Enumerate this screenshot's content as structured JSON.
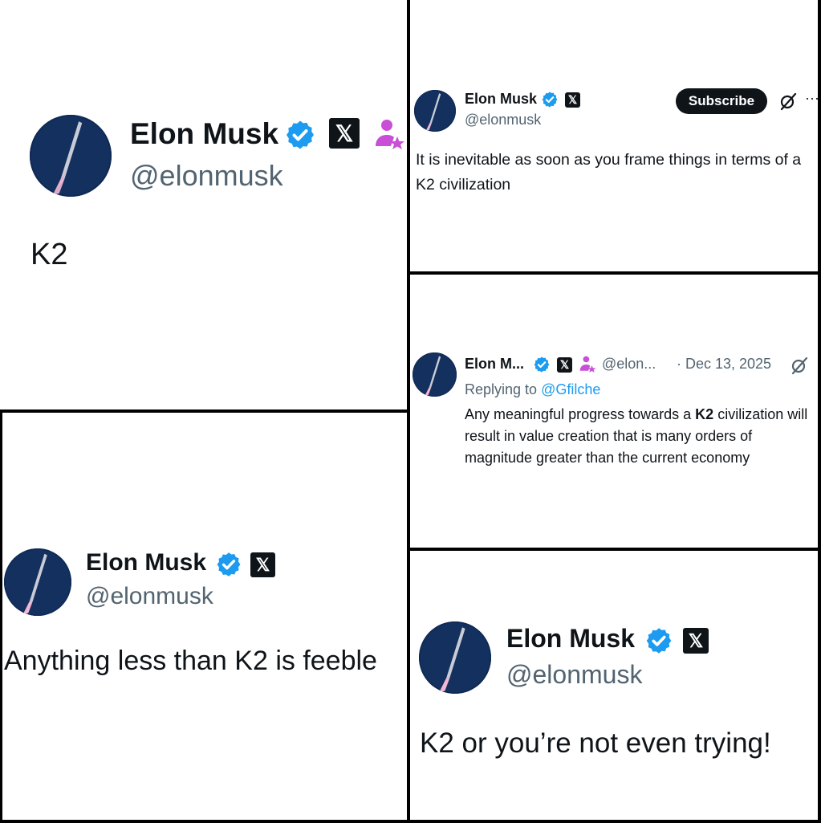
{
  "panels": {
    "p1": {
      "name": "Elon Musk",
      "handle": "@elonmusk",
      "text": "K2"
    },
    "p2": {
      "name": "Elon Musk",
      "handle": "@elonmusk",
      "subscribe_label": "Subscribe",
      "more_label": "···",
      "text": "It is inevitable as soon as you frame things in terms of a K2 civilization"
    },
    "p3": {
      "name": "Elon M...",
      "handle": "@elon...",
      "date": "· Dec 13, 2025",
      "replying_prefix": "Replying to",
      "replying_to": "@Gfilche",
      "text_before": "Any meaningful progress towards a",
      "text_bold": "K2",
      "text_after": "civilization will result in value creation that is many orders of magnitude greater than the current economy"
    },
    "p4": {
      "name": "Elon Musk",
      "handle": "@elonmusk",
      "text": "Anything less than K2 is feeble"
    },
    "p5": {
      "name": "Elon Musk",
      "handle": "@elonmusk",
      "text": "K2 or you’re not even trying!"
    }
  },
  "icons": {
    "verified": "verified-badge-icon",
    "x_logo": "x-logo-icon",
    "star_person": "person-star-icon",
    "grok": "grok-icon",
    "rocket": "rocket-avatar-icon"
  },
  "colors": {
    "verified_blue": "#1d9bf0",
    "handle_gray": "#536471",
    "badge_pink": "#c94fd7",
    "link_blue": "#1d9bf0",
    "divider": "#000000"
  }
}
